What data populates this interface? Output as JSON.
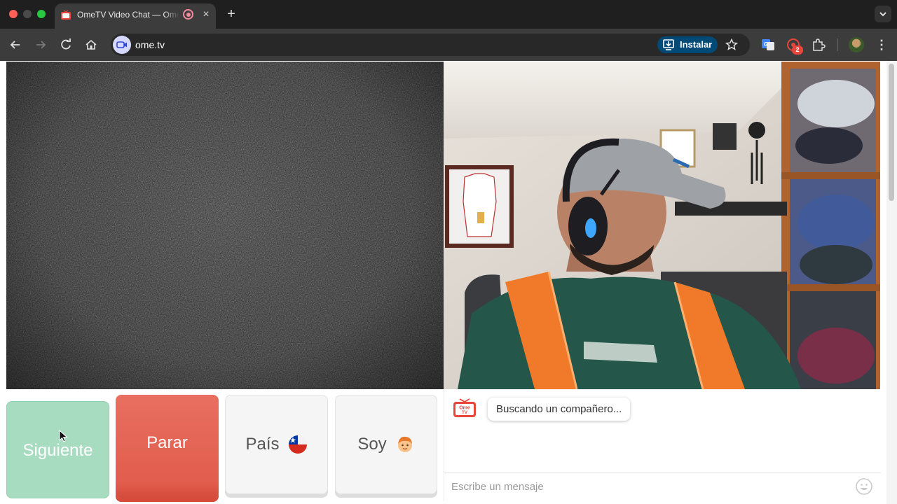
{
  "browser": {
    "tab": {
      "title": "OmeTV Video Chat — Omegle",
      "close_icon": "close-icon",
      "recording_icon": "recording-icon"
    },
    "new_tab_icon": "plus-icon",
    "url": "ome.tv",
    "install_label": "Instalar",
    "extension_badge": "2"
  },
  "page": {
    "buttons": {
      "next": "Siguiente",
      "stop": "Parar",
      "country": "País",
      "gender": "Soy"
    },
    "chat": {
      "status_message": "Buscando un compañero...",
      "input_placeholder": "Escribe un mensaje"
    }
  },
  "colors": {
    "next_button": "#a8dcc0",
    "stop_button": "#e25d4d",
    "neutral_button": "#f5f5f5",
    "install_button": "#004a77"
  }
}
